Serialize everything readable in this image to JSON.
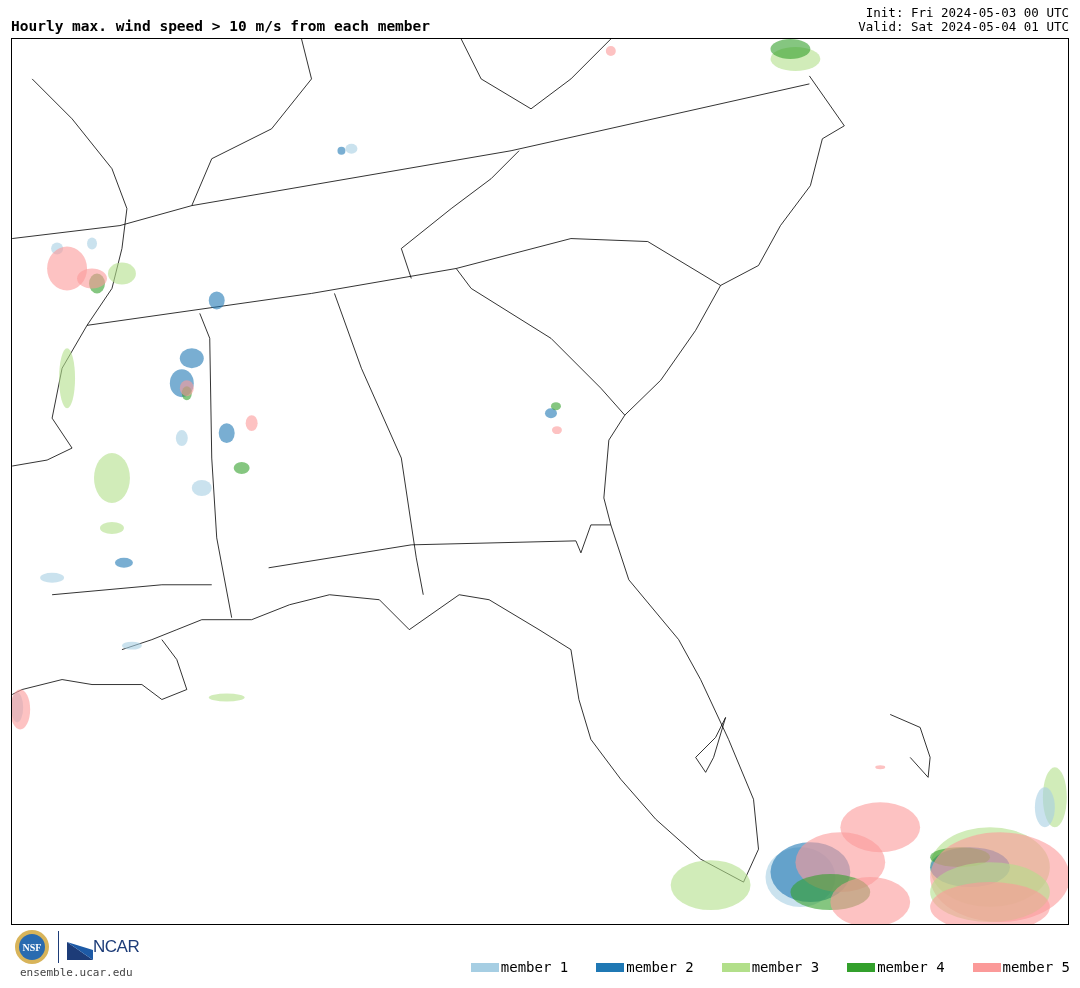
{
  "title": "Hourly max. wind speed > 10 m/s from each member",
  "init": "Init: Fri 2024-05-03 00 UTC",
  "valid": "Valid: Sat 2024-05-04 01 UTC",
  "logos": {
    "nsf": "NSF",
    "ncar": "NCAR"
  },
  "site": "ensemble.ucar.edu",
  "legend": [
    {
      "label": "member 1",
      "color": "#a6cee3"
    },
    {
      "label": "member 2",
      "color": "#1f78b4"
    },
    {
      "label": "member 3",
      "color": "#b2df8a"
    },
    {
      "label": "member 4",
      "color": "#33a02c"
    },
    {
      "label": "member 5",
      "color": "#fb9a99"
    }
  ]
}
